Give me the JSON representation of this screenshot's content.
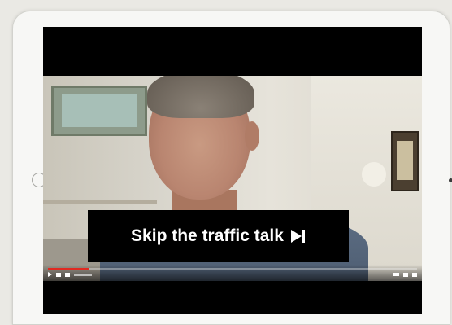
{
  "player": {
    "skip_button": {
      "label": "Skip the traffic talk",
      "icon": "skip-forward-icon"
    },
    "progress": 0.11,
    "accent_color": "#e02a22",
    "controls_icons": [
      "play-icon",
      "next-icon",
      "volume-icon",
      "settings-icon",
      "hd-icon",
      "fullscreen-icon"
    ]
  },
  "device": {
    "frame_color": "#f7f7f5",
    "screen_color": "#000000"
  }
}
